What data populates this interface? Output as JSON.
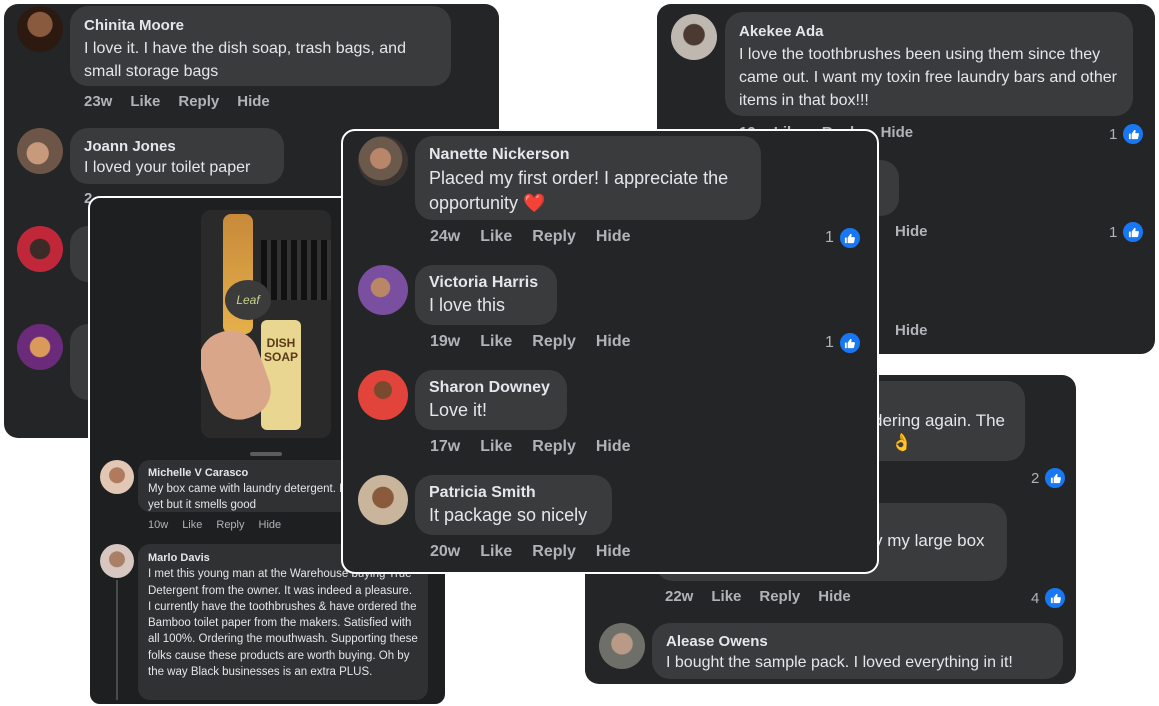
{
  "colors": {
    "panel": "#242526",
    "bubble": "#3a3b3c",
    "meta": "#b0b3b8",
    "like": "#1877f2"
  },
  "panel_top_left": {
    "comments": [
      {
        "name": "Chinita Moore",
        "text": "I love it. I have the dish soap, trash bags, and small storage bags",
        "time": "23w",
        "like": "Like",
        "reply": "Reply",
        "hide": "Hide"
      },
      {
        "name": "Joann Jones",
        "text": "I loved your toilet paper",
        "time": "2"
      }
    ]
  },
  "panel_top_right": {
    "comments": [
      {
        "name": "Akekee Ada",
        "text": "I love the toothbrushes been using them since they came out. I want my toxin free laundry bars and other items in that box!!!",
        "time": "19",
        "like": "Like",
        "reply": "Reply",
        "hide": "Hide",
        "likes": "1"
      }
    ],
    "partial_frag": "s",
    "hide2": "Hide",
    "likes2": "1",
    "hide3": "Hide"
  },
  "panel_video": {
    "comments": [
      {
        "name": "Michelle V Carasco",
        "text": "My box came with laundry detergent. I haven't used it yet but it smells good",
        "time": "10w",
        "like": "Like",
        "reply": "Reply",
        "hide": "Hide"
      },
      {
        "name": "Marlo Davis",
        "text": "I met this young man at the Warehouse buying True Detergent from the owner.  It was indeed a pleasure. I currently have the toothbrushes & have ordered the Bamboo toilet paper from the makers. Satisfied with all 100%. Ordering the mouthwash. Supporting these folks cause these products are worth buying. Oh by the way Black businesses is an extra PLUS."
      }
    ],
    "product_label_1": "DISH",
    "product_label_2": "SOAP",
    "product_label_3": "Leaf"
  },
  "panel_center": {
    "comments": [
      {
        "name": "Nanette Nickerson",
        "text": "Placed my first order! I appreciate the opportunity",
        "emoji": "❤️",
        "time": "24w",
        "like": "Like",
        "reply": "Reply",
        "hide": "Hide",
        "likes": "1"
      },
      {
        "name": "Victoria Harris",
        "text": "I love this",
        "time": "19w",
        "like": "Like",
        "reply": "Reply",
        "hide": "Hide",
        "likes": "1"
      },
      {
        "name": "Sharon Downey",
        "text": "Love it!",
        "time": "17w",
        "like": "Like",
        "reply": "Reply",
        "hide": "Hide"
      },
      {
        "name": "Patricia Smith",
        "text": "It package so nicely",
        "time": "20w",
        "like": "Like",
        "reply": "Reply",
        "hide": "Hide"
      }
    ]
  },
  "panel_bottom_right": {
    "frag1": "dering again. The",
    "frag1_emoji": "👌",
    "likes1": "2",
    "frag2": "y my large box",
    "time2": "22w",
    "like2": "Like",
    "reply2": "Reply",
    "hide2": "Hide",
    "likes2": "4",
    "comments": [
      {
        "name": "Alease Owens",
        "text": "I bought the sample pack. I loved everything in it!"
      }
    ]
  }
}
